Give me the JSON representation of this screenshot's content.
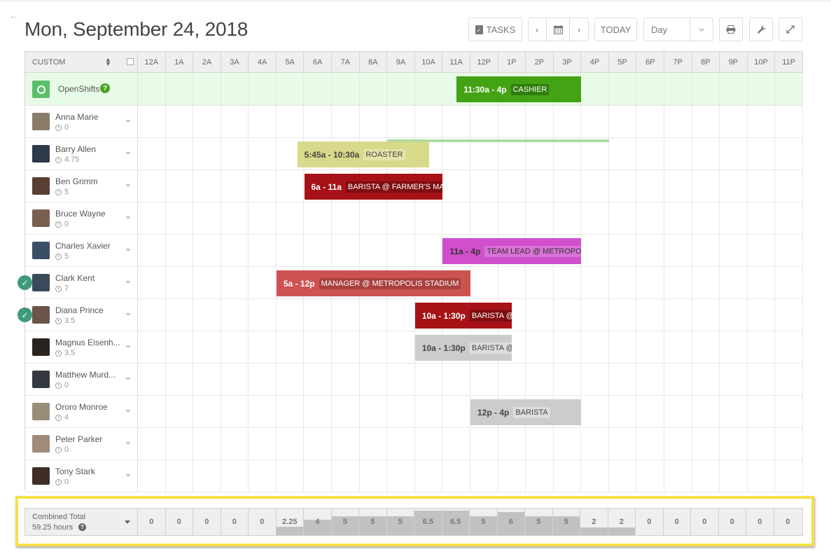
{
  "header": {
    "back_icon": "arrow-left-icon",
    "title": "Mon, September 24, 2018"
  },
  "toolbar": {
    "tasks_label": "TASKS",
    "prev_icon": "chevron-left-icon",
    "calendar_icon": "calendar-icon",
    "next_icon": "chevron-right-icon",
    "today_label": "TODAY",
    "view_select_value": "Day",
    "print_icon": "print-icon",
    "settings_icon": "wrench-icon",
    "fullscreen_icon": "expand-icon"
  },
  "grid": {
    "sort_label": "CUSTOM",
    "hours": [
      "12A",
      "1A",
      "2A",
      "3A",
      "4A",
      "5A",
      "6A",
      "7A",
      "8A",
      "9A",
      "10A",
      "11A",
      "12P",
      "1P",
      "2P",
      "3P",
      "4P",
      "5P",
      "6P",
      "7P",
      "8P",
      "9P",
      "10P",
      "11P"
    ],
    "open_shifts": {
      "label": "OpenShifts",
      "shifts": [
        {
          "start": 11.5,
          "end": 16,
          "time": "11:30a - 4p",
          "position": "CASHIER",
          "color": "#44a315",
          "text_color": "#ffffff",
          "tag_bg": "#2f7d0c"
        }
      ]
    },
    "employees": [
      {
        "name": "Anna Marie",
        "hours": "0",
        "checked": false,
        "avatar_color": "#8a7a6a",
        "shifts": []
      },
      {
        "name": "Barry Allen",
        "hours": "4.75",
        "checked": false,
        "avatar_color": "#2d3a4a",
        "shifts": [
          {
            "start": 5.75,
            "end": 10.5,
            "time": "5:45a - 10:30a",
            "position": "ROASTER",
            "color": "#d9d98b",
            "text_color": "#444444",
            "tag_bg": "#e4e4a8"
          }
        ],
        "availability": {
          "start": 9,
          "end": 17,
          "color": "#a8dca0"
        }
      },
      {
        "name": "Ben Grimm",
        "hours": "5",
        "checked": false,
        "avatar_color": "#5a3f35",
        "shifts": [
          {
            "start": 6,
            "end": 11,
            "time": "6a - 11a",
            "position": "BARISTA @ FARMER'S MAI",
            "color": "#a71216",
            "text_color": "#ffffff",
            "tag_bg": "#7e0d10"
          }
        ]
      },
      {
        "name": "Bruce Wayne",
        "hours": "0",
        "checked": false,
        "avatar_color": "#7a5e52",
        "shifts": []
      },
      {
        "name": "Charles Xavier",
        "hours": "5",
        "checked": false,
        "avatar_color": "#3c4d66",
        "shifts": [
          {
            "start": 11,
            "end": 16,
            "time": "11a - 4p",
            "position": "TEAM LEAD @ METROPOL",
            "color": "#cf4fcc",
            "text_color": "#333333",
            "tag_bg": "#d972d6"
          }
        ]
      },
      {
        "name": "Clark Kent",
        "hours": "7",
        "checked": true,
        "avatar_color": "#3a4a5a",
        "shifts": [
          {
            "start": 5,
            "end": 12,
            "time": "5a - 12p",
            "position": "MANAGER @ METROPOLIS STADIUM",
            "color": "#cd5353",
            "text_color": "#ffffff",
            "tag_bg": "#a94040"
          }
        ]
      },
      {
        "name": "Diana Prince",
        "hours": "3.5",
        "checked": true,
        "avatar_color": "#6a5548",
        "shifts": [
          {
            "start": 10,
            "end": 13.5,
            "time": "10a - 1:30p",
            "position": "BARISTA @",
            "color": "#a71216",
            "text_color": "#ffffff",
            "tag_bg": "#7e0d10"
          }
        ]
      },
      {
        "name": "Magnus Eisenh...",
        "hours": "3.5",
        "checked": false,
        "avatar_color": "#2a2420",
        "shifts": [
          {
            "start": 10,
            "end": 13.5,
            "time": "10a - 1:30p",
            "position": "BARISTA @",
            "color": "#cccccc",
            "text_color": "#444444",
            "tag_bg": "#dddddd"
          }
        ]
      },
      {
        "name": "Matthew Murd...",
        "hours": "0",
        "checked": false,
        "avatar_color": "#34393f",
        "shifts": []
      },
      {
        "name": "Ororo Monroe",
        "hours": "4",
        "checked": false,
        "avatar_color": "#9a8c7a",
        "shifts": [
          {
            "start": 12,
            "end": 16,
            "time": "12p - 4p",
            "position": "BARISTA",
            "color": "#cccccc",
            "text_color": "#444444",
            "tag_bg": "#dddddd"
          }
        ]
      },
      {
        "name": "Peter Parker",
        "hours": "0",
        "checked": false,
        "avatar_color": "#a08a78",
        "shifts": []
      },
      {
        "name": "Tony Stark",
        "hours": "0",
        "checked": false,
        "avatar_color": "#3e2e26",
        "shifts": []
      }
    ]
  },
  "footer": {
    "label": "Combined Total",
    "total": "59.25 hours",
    "help_icon": "question-circle-icon",
    "max_value": 7,
    "values": [
      0,
      0,
      0,
      0,
      0,
      2.25,
      4,
      5,
      5,
      5,
      6.5,
      6.5,
      5,
      6,
      5,
      5,
      2,
      2,
      0,
      0,
      0,
      0,
      0,
      0
    ],
    "labels": [
      "0",
      "0",
      "0",
      "0",
      "0",
      "2.25",
      "4",
      "5",
      "5",
      "5",
      "6.5",
      "6.5",
      "5",
      "6",
      "5",
      "5",
      "2",
      "2",
      "0",
      "0",
      "0",
      "0",
      "0",
      "0"
    ]
  }
}
